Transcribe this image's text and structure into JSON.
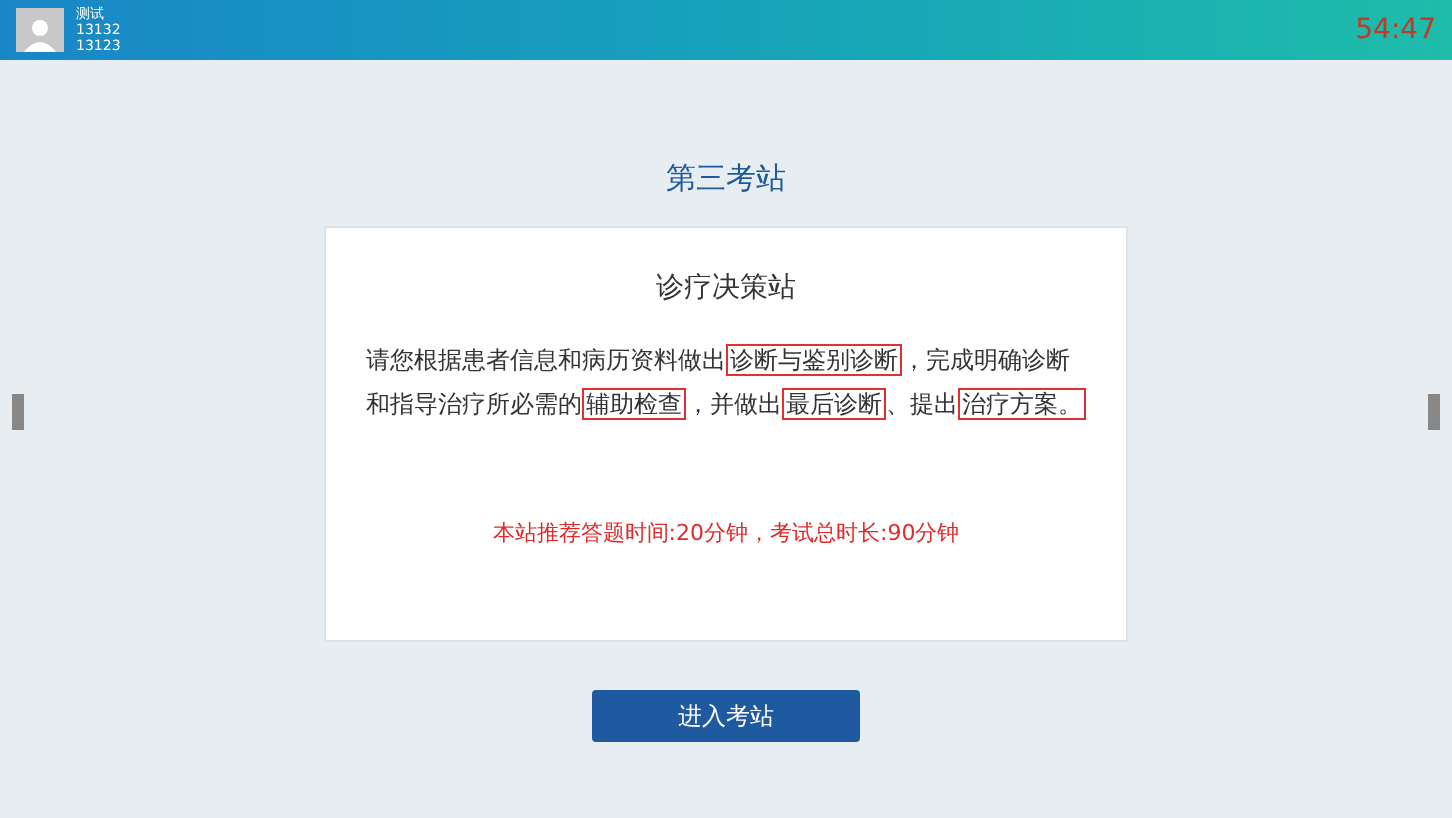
{
  "header": {
    "user": {
      "name": "测试",
      "line_1": "13132",
      "line_2": "13123"
    },
    "timer": "54:47"
  },
  "station_title": "第三考站",
  "card": {
    "title": "诊疗决策站",
    "instruction": [
      {
        "text": "请您根据患者信息和病历资料做出",
        "boxed": false
      },
      {
        "text": "诊断与鉴别诊断",
        "boxed": true
      },
      {
        "text": "，完成明确诊断和指导治疗所必需的",
        "boxed": false
      },
      {
        "text": "辅助检查",
        "boxed": true
      },
      {
        "text": "，并做出",
        "boxed": false
      },
      {
        "text": "最后诊断",
        "boxed": true
      },
      {
        "text": "、提出",
        "boxed": false
      },
      {
        "text": "治疗方案。",
        "boxed": true
      }
    ],
    "time_note": "本站推荐答题时间:20分钟，考试总时长:90分钟"
  },
  "enter_button": "进入考站"
}
